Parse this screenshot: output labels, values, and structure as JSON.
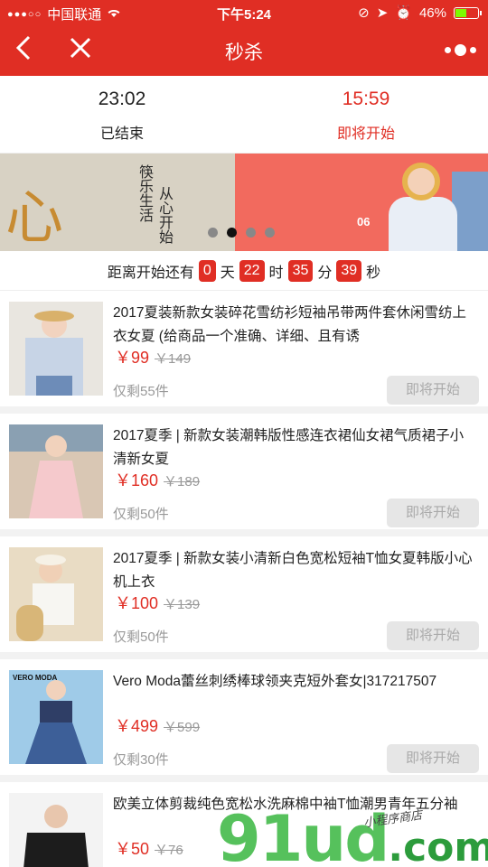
{
  "status_bar": {
    "carrier": "中国联通",
    "time": "下午5:24",
    "battery": "46%",
    "battery_color": "#7cfc00"
  },
  "nav": {
    "title": "秒杀",
    "back_icon": "chevron-left-icon",
    "close_icon": "close-icon",
    "more_icon": "more-dots-icon",
    "color": "#e02e24"
  },
  "time_tabs": [
    {
      "time": "23:02",
      "status": "已结束"
    },
    {
      "time": "15:59",
      "status": "即将开始"
    }
  ],
  "banner": {
    "big_char": "心",
    "poem_line1": "筷乐生活",
    "poem_line2": "从心开始",
    "promo_tag": "06",
    "slide_count": 4,
    "active_slide": 2
  },
  "countdown": {
    "prefix": "距离开始还有",
    "days": "0",
    "days_unit": "天",
    "hours": "22",
    "hours_unit": "时",
    "minutes": "35",
    "minutes_unit": "分",
    "seconds": "39",
    "seconds_unit": "秒"
  },
  "products": [
    {
      "name": "2017夏装新款女装碎花雪纺衫短袖吊带两件套休闲雪纺上衣女夏 (给商品一个准确、详细、且有诱",
      "price": "￥99",
      "original_price": "￥149",
      "stock": "仅剩55件",
      "button": "即将开始"
    },
    {
      "name": "2017夏季 | 新款女装潮韩版性感连衣裙仙女裙气质裙子小清新女夏",
      "price": "￥160",
      "original_price": "￥189",
      "stock": "仅剩50件",
      "button": "即将开始"
    },
    {
      "name": "2017夏季 | 新款女装小清新白色宽松短袖T恤女夏韩版小心机上衣",
      "price": "￥100",
      "original_price": "￥139",
      "stock": "仅剩50件",
      "button": "即将开始"
    },
    {
      "name": "Vero Moda蕾丝刺绣棒球领夹克短外套女|317217507",
      "price": "￥499",
      "original_price": "￥599",
      "stock": "仅剩30件",
      "button": "即将开始"
    },
    {
      "name": "欧美立体剪裁纯色宽松水洗麻棉中袖T恤潮男青年五分袖",
      "price": "￥50",
      "original_price": "￥76",
      "stock": "",
      "button": ""
    }
  ],
  "thumb_labels": {
    "vero_moda": "VERO MODA"
  },
  "watermark": {
    "text": "91ud",
    "dot_com": ".com",
    "sub": "小程序商店"
  }
}
